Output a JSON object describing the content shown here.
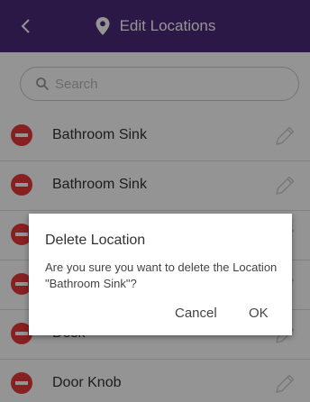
{
  "header": {
    "title": "Edit Locations",
    "background_color": "#4a2a7a",
    "back_icon": "chevron-left-icon",
    "title_icon": "map-pin-icon"
  },
  "search": {
    "placeholder": "Search",
    "value": "",
    "icon": "search-icon"
  },
  "list": {
    "delete_icon": "minus-circle-icon",
    "delete_color": "#e8383a",
    "edit_icon": "pencil-icon",
    "items": [
      {
        "label": "Bathroom Sink"
      },
      {
        "label": "Bathroom Sink"
      },
      {
        "label": ""
      },
      {
        "label": ""
      },
      {
        "label": "Desk"
      },
      {
        "label": "Door Knob"
      }
    ]
  },
  "dialog": {
    "title": "Delete Location",
    "message": "Are you sure you want to delete the Location \"Bathroom Sink\"?",
    "cancel_label": "Cancel",
    "ok_label": "OK"
  }
}
